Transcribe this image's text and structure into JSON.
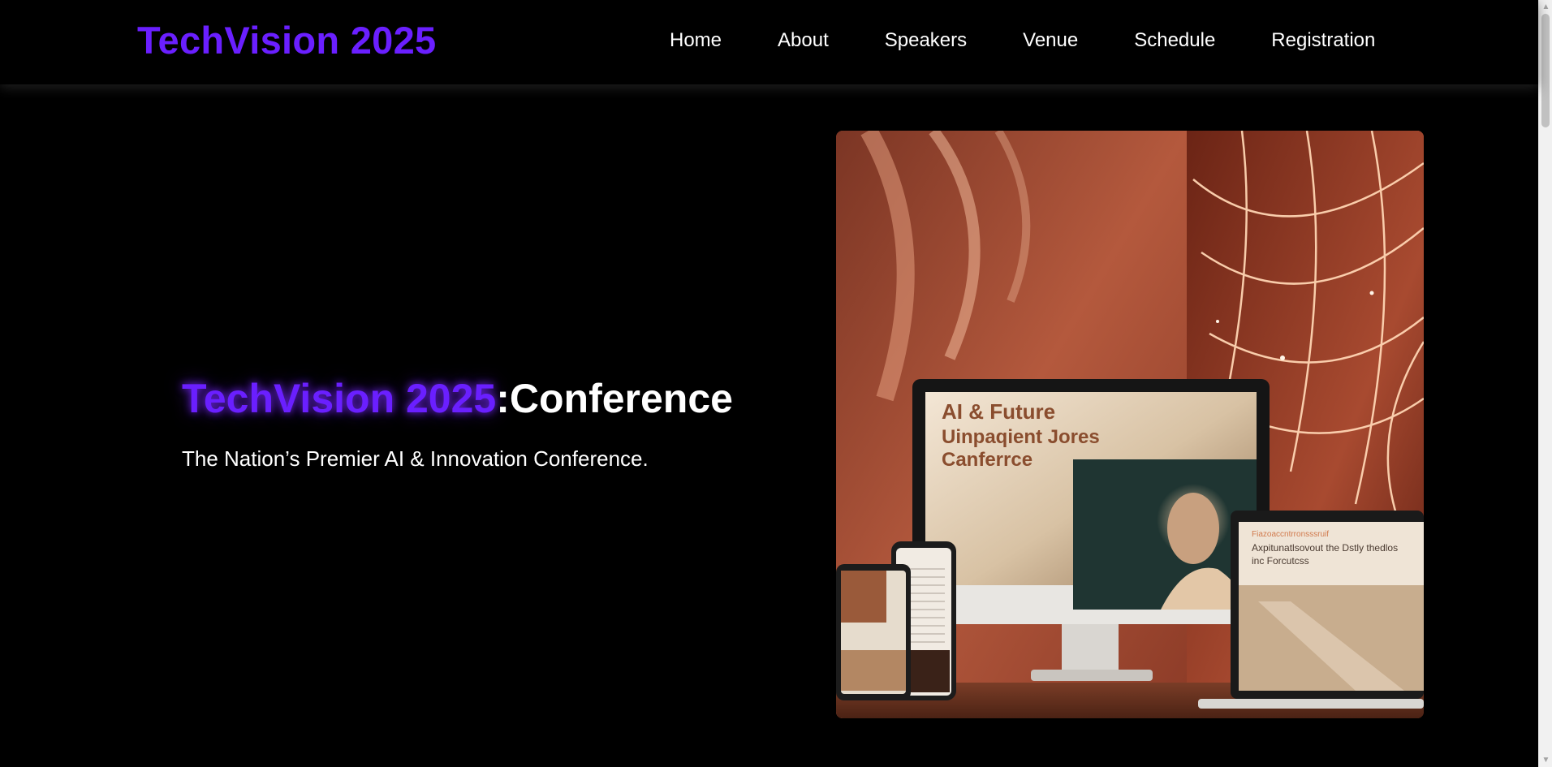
{
  "header": {
    "logo": "TechVision 2025",
    "nav": [
      "Home",
      "About",
      "Speakers",
      "Venue",
      "Schedule",
      "Registration"
    ]
  },
  "hero": {
    "title_brand": "TechVision 2025",
    "title_rest": ":Conference",
    "subtitle": "The Nation’s Premier AI & Innovation Conference.",
    "image_texts": {
      "monitor_headline": [
        "AI & Future",
        "Uinpaqient Jores",
        "Canferrce"
      ],
      "laptop_small": "Fiazoaccntrronsssruif",
      "laptop_line1": "Axpitunatlsovout the Dstly thedlos",
      "laptop_line2": "inc Forcutcss"
    }
  },
  "colors": {
    "accent": "#6a1fff",
    "background": "#000000",
    "text": "#ffffff"
  },
  "icons": {
    "scroll_up": "triangle-up",
    "scroll_down": "triangle-down"
  }
}
